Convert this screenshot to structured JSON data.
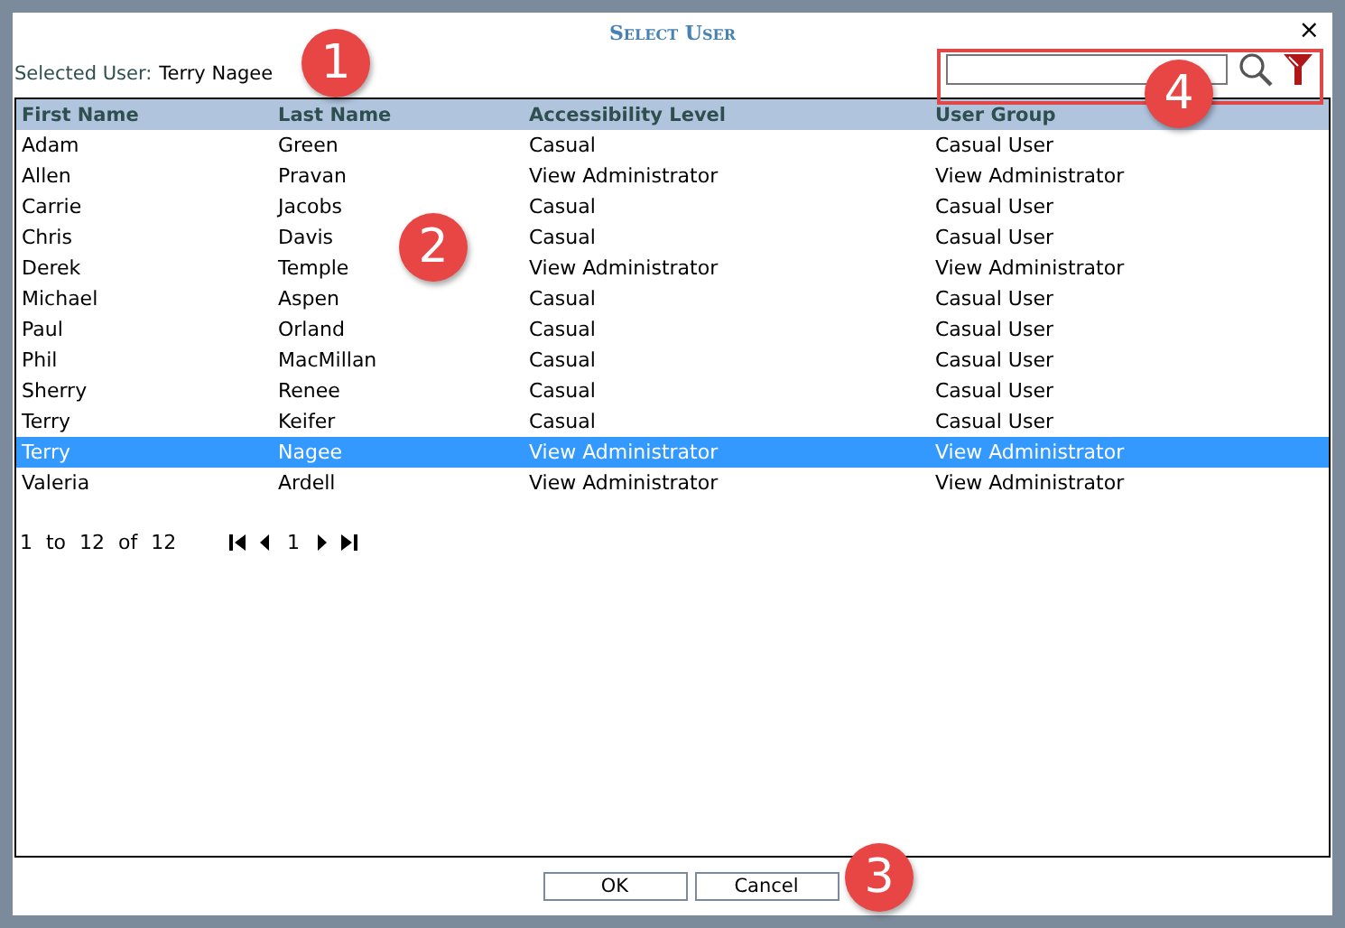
{
  "dialog": {
    "title": "Select User",
    "close": "×"
  },
  "selected_user": {
    "label": "Selected User:",
    "value": "Terry Nagee"
  },
  "table": {
    "columns": [
      "First Name",
      "Last Name",
      "Accessibility Level",
      "User Group"
    ],
    "rows": [
      {
        "cells": [
          "Adam",
          "Green",
          "Casual",
          "Casual User"
        ],
        "selected": false
      },
      {
        "cells": [
          "Allen",
          "Pravan",
          "View Administrator",
          "View Administrator"
        ],
        "selected": false
      },
      {
        "cells": [
          "Carrie",
          "Jacobs",
          "Casual",
          "Casual User"
        ],
        "selected": false
      },
      {
        "cells": [
          "Chris",
          "Davis",
          "Casual",
          "Casual User"
        ],
        "selected": false
      },
      {
        "cells": [
          "Derek",
          "Temple",
          "View Administrator",
          "View Administrator"
        ],
        "selected": false
      },
      {
        "cells": [
          "Michael",
          "Aspen",
          "Casual",
          "Casual User"
        ],
        "selected": false
      },
      {
        "cells": [
          "Paul",
          "Orland",
          "Casual",
          "Casual User"
        ],
        "selected": false
      },
      {
        "cells": [
          "Phil",
          "MacMillan",
          "Casual",
          "Casual User"
        ],
        "selected": false
      },
      {
        "cells": [
          "Sherry",
          "Renee",
          "Casual",
          "Casual User"
        ],
        "selected": false
      },
      {
        "cells": [
          "Terry",
          "Keifer",
          "Casual",
          "Casual User"
        ],
        "selected": false
      },
      {
        "cells": [
          "Terry",
          "Nagee",
          "View Administrator",
          "View Administrator"
        ],
        "selected": true
      },
      {
        "cells": [
          "Valeria",
          "Ardell",
          "View Administrator",
          "View Administrator"
        ],
        "selected": false
      }
    ]
  },
  "pagination": {
    "range": "1 to 12 of 12",
    "page": "1"
  },
  "buttons": [
    "OK",
    "Cancel"
  ],
  "callouts": [
    "1",
    "2",
    "3",
    "4"
  ]
}
